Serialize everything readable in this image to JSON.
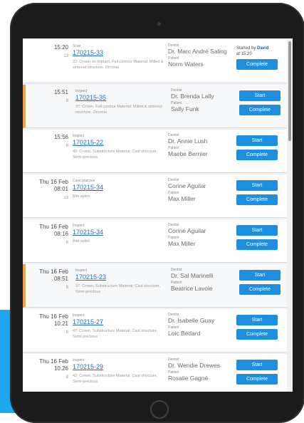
{
  "colors": {
    "accent_blue": "#1ea6ee",
    "button_blue": "#1e8fde",
    "highlight_orange": "#f5a23c",
    "link_blue": "#2a6fb8"
  },
  "labels": {
    "dentist": "Dentist",
    "patient": "Patient",
    "start": "Start",
    "complete": "Complete"
  },
  "rows": [
    {
      "time": "15:20",
      "time_sub": "13",
      "type": "Scan",
      "case_id": "170215-33",
      "desc": "22: Crown on implant, Full contour Material: Milled & sintered structure, Zirconia",
      "dentist": "Dr. Marc André Saling",
      "patient": "Norm Waters",
      "started_prefix": "Started by ",
      "started_by": "David",
      "started_time": "at 15:20",
      "highlight": false,
      "show_start": false
    },
    {
      "time": "15:51",
      "time_sub": "8",
      "type": "Inspect",
      "case_id": "170215-35",
      "desc": "37: Crown, Full contour Material: Milled & sintered structure, Zirconia",
      "dentist": "Dr. Brenda Lally",
      "patient": "Sally Funk",
      "highlight": true,
      "show_start": true
    },
    {
      "time": "15:56",
      "time_sub": "8",
      "type": "Inspect",
      "case_id": "170215-22",
      "desc": "43: Crown, Substructure Material: Cast structure, Semi-precious",
      "dentist": "Dr. Annie Lush",
      "patient": "Maebe Bernier",
      "highlight": false,
      "show_start": true
    },
    {
      "time": "Thu 16 Feb",
      "time2": "08:01",
      "time_sub": "13",
      "type": "Case analysis",
      "case_id": "170215-34",
      "desc": "Bite splint",
      "dentist": "Corine Aguilar",
      "patient": "Max Miller",
      "highlight": false,
      "show_start": true
    },
    {
      "time": "Thu 16 Feb",
      "time2": "08:16",
      "time_sub": "8",
      "type": "Inspect",
      "case_id": "170215-34",
      "desc": "Bite splint",
      "dentist": "Corine Aguilar",
      "patient": "Max Miller",
      "highlight": false,
      "show_start": true
    },
    {
      "time": "Thu 16 Feb",
      "time2": "08:51",
      "time_sub": "8",
      "type": "Inspect",
      "case_id": "170215-23",
      "desc": "37: Crown, Substructure Material: Cast structure, Semi-precious",
      "dentist": "Dr. Sal Marinelli",
      "patient": "Beatrice Lavoie",
      "highlight": true,
      "show_start": true
    },
    {
      "time": "Thu 16 Feb",
      "time2": "10:21",
      "time_sub": "8",
      "type": "Inspect",
      "case_id": "170215-27",
      "desc": "47: Crown, Substructure Material: Cast structure, Semi-precious",
      "dentist": "Dr. Isabelle Guay",
      "patient": "Loic Bédard",
      "highlight": false,
      "show_start": true
    },
    {
      "time": "Thu 16 Feb",
      "time2": "10:26",
      "time_sub": "8",
      "type": "Inspect",
      "case_id": "170215-29",
      "desc": "42: Crown, Substructure Material: Cast structure, Semi-precious",
      "dentist": "Dr. Wendie Drewes",
      "patient": "Rosalie Gagné",
      "highlight": false,
      "show_start": true
    }
  ]
}
